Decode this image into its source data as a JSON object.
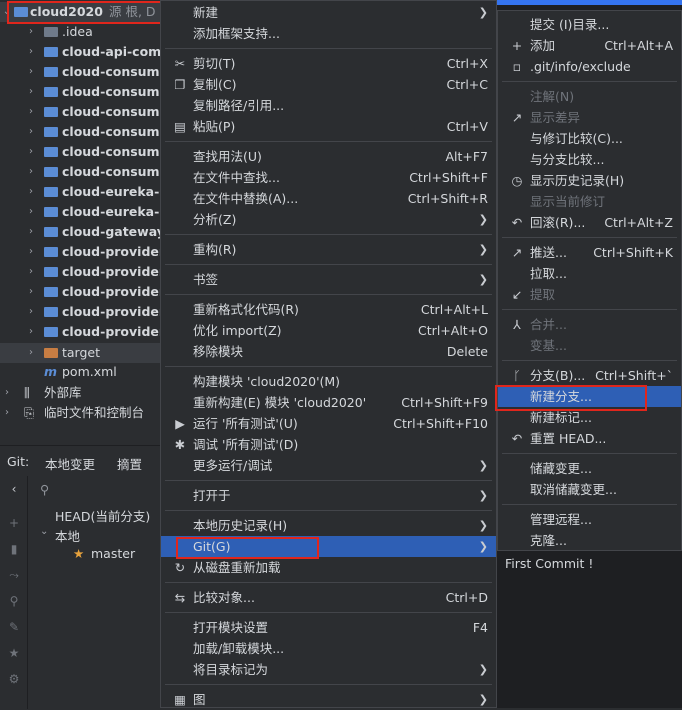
{
  "tree": {
    "root_label": "cloud2020",
    "root_suffix": "源 根, D",
    "items": [
      {
        "label": ".idea",
        "type": "folder"
      },
      {
        "label": "cloud-api-comm",
        "type": "module"
      },
      {
        "label": "cloud-consumer",
        "type": "module"
      },
      {
        "label": "cloud-consumer",
        "type": "module"
      },
      {
        "label": "cloud-consumer",
        "type": "module"
      },
      {
        "label": "cloud-consumer",
        "type": "module"
      },
      {
        "label": "cloud-consumer",
        "type": "module"
      },
      {
        "label": "cloud-consumer",
        "type": "module"
      },
      {
        "label": "cloud-eureka-se",
        "type": "module"
      },
      {
        "label": "cloud-eureka-se",
        "type": "module"
      },
      {
        "label": "cloud-gateway-",
        "type": "module"
      },
      {
        "label": "cloud-provider-",
        "type": "module"
      },
      {
        "label": "cloud-provider-",
        "type": "module"
      },
      {
        "label": "cloud-provider-",
        "type": "module"
      },
      {
        "label": "cloud-provider-",
        "type": "module"
      },
      {
        "label": "cloud-provider-",
        "type": "module"
      },
      {
        "label": "target",
        "type": "target"
      },
      {
        "label": "pom.xml",
        "type": "file"
      }
    ],
    "ext_libs": "外部库",
    "scratches": "临时文件和控制台"
  },
  "git_panel": {
    "tabs": [
      "Git:",
      "本地变更",
      "摘置"
    ],
    "head": "HEAD(当前分支)",
    "local": "本地",
    "master": "master"
  },
  "context_menu": [
    {
      "label": "新建",
      "sub": true
    },
    {
      "label": "添加框架支持..."
    },
    {
      "sep": true
    },
    {
      "label": "剪切(T)",
      "sc": "Ctrl+X",
      "icon": "✂"
    },
    {
      "label": "复制(C)",
      "sc": "Ctrl+C",
      "icon": "❐"
    },
    {
      "label": "复制路径/引用..."
    },
    {
      "label": "粘贴(P)",
      "sc": "Ctrl+V",
      "icon": "▤"
    },
    {
      "sep": true
    },
    {
      "label": "查找用法(U)",
      "sc": "Alt+F7"
    },
    {
      "label": "在文件中查找...",
      "sc": "Ctrl+Shift+F"
    },
    {
      "label": "在文件中替换(A)...",
      "sc": "Ctrl+Shift+R"
    },
    {
      "label": "分析(Z)",
      "sub": true
    },
    {
      "sep": true
    },
    {
      "label": "重构(R)",
      "sub": true
    },
    {
      "sep": true
    },
    {
      "label": "书签",
      "sub": true
    },
    {
      "sep": true
    },
    {
      "label": "重新格式化代码(R)",
      "sc": "Ctrl+Alt+L"
    },
    {
      "label": "优化 import(Z)",
      "sc": "Ctrl+Alt+O"
    },
    {
      "label": "移除模块",
      "sc": "Delete"
    },
    {
      "sep": true
    },
    {
      "label": "构建模块 'cloud2020'(M)"
    },
    {
      "label": "重新构建(E) 模块 'cloud2020'",
      "sc": "Ctrl+Shift+F9"
    },
    {
      "label": "运行 '所有测试'(U)",
      "sc": "Ctrl+Shift+F10",
      "icon": "▶"
    },
    {
      "label": "调试 '所有测试'(D)",
      "icon": "✱"
    },
    {
      "label": "更多运行/调试",
      "sub": true
    },
    {
      "sep": true
    },
    {
      "label": "打开于",
      "sub": true
    },
    {
      "sep": true
    },
    {
      "label": "本地历史记录(H)",
      "sub": true
    },
    {
      "label": "Git(G)",
      "sub": true,
      "hl": true
    },
    {
      "label": "从磁盘重新加载",
      "icon": "↻"
    },
    {
      "sep": true
    },
    {
      "label": "比较对象...",
      "sc": "Ctrl+D",
      "icon": "⇆"
    },
    {
      "sep": true
    },
    {
      "label": "打开模块设置",
      "sc": "F4"
    },
    {
      "label": "加载/卸载模块..."
    },
    {
      "label": "将目录标记为",
      "sub": true
    },
    {
      "sep": true
    },
    {
      "label": "图",
      "sub": true,
      "icon": "▦"
    }
  ],
  "git_menu": [
    {
      "label": "提交 (I)目录..."
    },
    {
      "label": "添加",
      "sc": "Ctrl+Alt+A",
      "icon": "+"
    },
    {
      "label": ".git/info/exclude",
      "icon": "▫"
    },
    {
      "sep": true
    },
    {
      "label": "注解(N)",
      "dis": true
    },
    {
      "label": "显示差异",
      "dis": true,
      "icon": "↗"
    },
    {
      "label": "与修订比较(C)..."
    },
    {
      "label": "与分支比较..."
    },
    {
      "label": "显示历史记录(H)",
      "icon": "◷"
    },
    {
      "label": "显示当前修订",
      "dis": true
    },
    {
      "label": "回滚(R)...",
      "sc": "Ctrl+Alt+Z",
      "icon": "↶"
    },
    {
      "sep": true
    },
    {
      "label": "推送...",
      "sc": "Ctrl+Shift+K",
      "icon": "↗"
    },
    {
      "label": "拉取..."
    },
    {
      "label": "提取",
      "dis": true,
      "icon": "↙"
    },
    {
      "sep": true
    },
    {
      "label": "合并...",
      "dis": true,
      "icon": "⅄"
    },
    {
      "label": "变基...",
      "dis": true
    },
    {
      "sep": true
    },
    {
      "label": "分支(B)...",
      "sc": "Ctrl+Shift+`",
      "icon": "ᚴ"
    },
    {
      "label": "新建分支...",
      "hl": true
    },
    {
      "label": "新建标记..."
    },
    {
      "label": "重置 HEAD...",
      "icon": "↶"
    },
    {
      "sep": true
    },
    {
      "label": "储藏变更..."
    },
    {
      "label": "取消储藏变更..."
    },
    {
      "sep": true
    },
    {
      "label": "管理远程..."
    },
    {
      "label": "克隆..."
    }
  ],
  "commit_label": "First Commit !",
  "colors": {
    "highlight": "#2e5fb5",
    "annotation": "#e0261c"
  }
}
